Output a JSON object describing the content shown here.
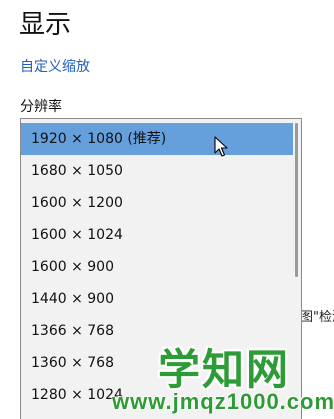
{
  "page": {
    "title": "显示",
    "custom_scale_link": "自定义缩放",
    "resolution_label": "分辨率",
    "partial_background_text": "图\"检测"
  },
  "dropdown": {
    "selected_index": 0,
    "options": [
      "1920 × 1080 (推荐)",
      "1680 × 1050",
      "1600 × 1200",
      "1600 × 1024",
      "1600 × 900",
      "1440 × 900",
      "1366 × 768",
      "1360 × 768",
      "1280 × 1024"
    ],
    "selected_color": "#65a0dd"
  },
  "watermark": {
    "title": "学知网",
    "url": "www.jmqz1000.com",
    "color": "#2d9b36"
  }
}
